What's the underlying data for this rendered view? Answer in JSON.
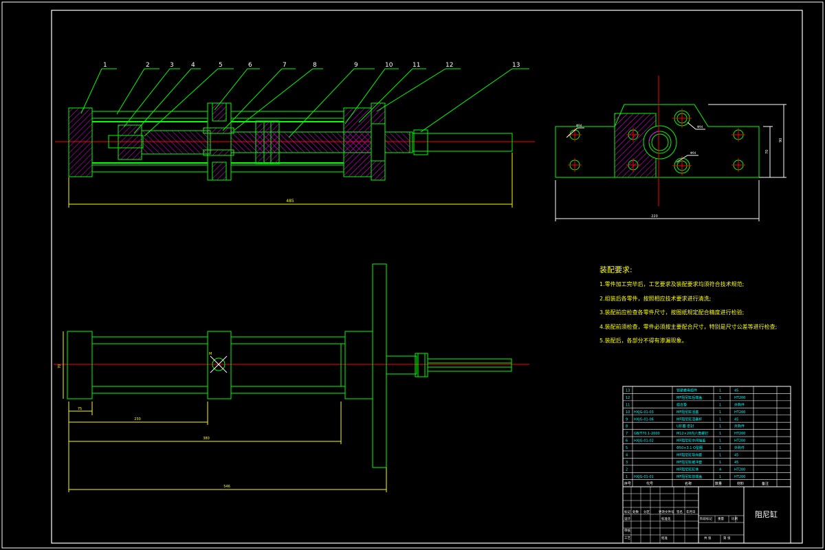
{
  "drawing": {
    "title": "阻尼缸",
    "colors": {
      "background": "#000000",
      "outline": "#ffffff",
      "part": "#00ff00",
      "hatch": "#ff00ff",
      "centerline": "#ff0000",
      "dimension": "#ffff00",
      "table_text": "#00ffff"
    }
  },
  "balloons": [
    "1",
    "2",
    "3",
    "4",
    "5",
    "6",
    "7",
    "8",
    "9",
    "10",
    "11",
    "12",
    "13"
  ],
  "dimensions": {
    "top_length": "485",
    "side_width": "220",
    "side_h1": "70",
    "side_h2": "90",
    "bot_left": "75",
    "bot_mid": "230",
    "bot_long": "380",
    "bot_total": "546",
    "bot_height": "70",
    "circle_dims": [
      "Φ94",
      "Φ94",
      "Φ94"
    ]
  },
  "requirements": {
    "title": "装配要求:",
    "lines": [
      "1.零件加工完毕后，工艺要求及装配要求均须符合技术规范;",
      "2.组装后各零件，按照相应技术要求进行清洗;",
      "3.装配前应检查各零件尺寸，按图纸规定配合精度进行检验;",
      "4.装配前须检查，零件必须按主要配合尺寸，特别是尺寸公差等进行检查;",
      "5.装配后，各部分不得有渗漏现象。"
    ]
  },
  "bom": {
    "rows": [
      {
        "no": "13",
        "code": "",
        "name": "锁紧螺母组件",
        "qty": "1",
        "mat": "45",
        "note": ""
      },
      {
        "no": "12",
        "code": "",
        "name": "MF阻尼缸后端盖",
        "qty": "1",
        "mat": "HT200",
        "note": ""
      },
      {
        "no": "11",
        "code": "",
        "name": "组合垫",
        "qty": "1",
        "mat": "外购件",
        "note": ""
      },
      {
        "no": "10",
        "code": "HXJG-01-03",
        "name": "MF阻尼缸活塞",
        "qty": "1",
        "mat": "HT200",
        "note": ""
      },
      {
        "no": "9",
        "code": "HXJG-01-06",
        "name": "MF阻尼缸活塞杆",
        "qty": "1",
        "mat": "45",
        "note": ""
      },
      {
        "no": "8",
        "code": "",
        "name": "U形圈 密封",
        "qty": "1",
        "mat": "外购件",
        "note": ""
      },
      {
        "no": "7",
        "code": "GB/T70.1-2000",
        "name": "M12×20内六角螺钉",
        "qty": "1",
        "mat": "HT200",
        "note": ""
      },
      {
        "no": "6",
        "code": "HXJG-01-02",
        "name": "MF阻尼缸中间端盖",
        "qty": "1",
        "mat": "HT200",
        "note": ""
      },
      {
        "no": "5",
        "code": "",
        "name": "Φ50×3.1 O型圈",
        "qty": "1",
        "mat": "外购件",
        "note": ""
      },
      {
        "no": "4",
        "code": "",
        "name": "MF阻尼缸导向套",
        "qty": "1",
        "mat": "45",
        "note": ""
      },
      {
        "no": "3",
        "code": "",
        "name": "MF阻尼缸缓冲套",
        "qty": "1",
        "mat": "45",
        "note": ""
      },
      {
        "no": "2",
        "code": "",
        "name": "MF阻尼缸缸体",
        "qty": "4",
        "mat": "HT200",
        "note": ""
      },
      {
        "no": "1",
        "code": "HXJG-01-01",
        "name": "MF阻尼缸前端盖",
        "qty": "1",
        "mat": "HT200",
        "note": ""
      }
    ],
    "headers": {
      "no": "序号",
      "code": "代号",
      "name": "名称",
      "qty": "数量",
      "mat": "材料",
      "note": "备注"
    }
  },
  "title_block": {
    "left_rows": [
      "标记",
      "设计",
      "审核",
      "工艺"
    ],
    "cols": [
      "处数",
      "分区",
      "更改文件号",
      "签名",
      "年月日"
    ],
    "mid_labels": [
      "标准化",
      "批准"
    ],
    "right_labels": [
      "阶段标记",
      "重量",
      "比例"
    ],
    "sheet_labels": [
      "共 张",
      "第 张"
    ]
  }
}
